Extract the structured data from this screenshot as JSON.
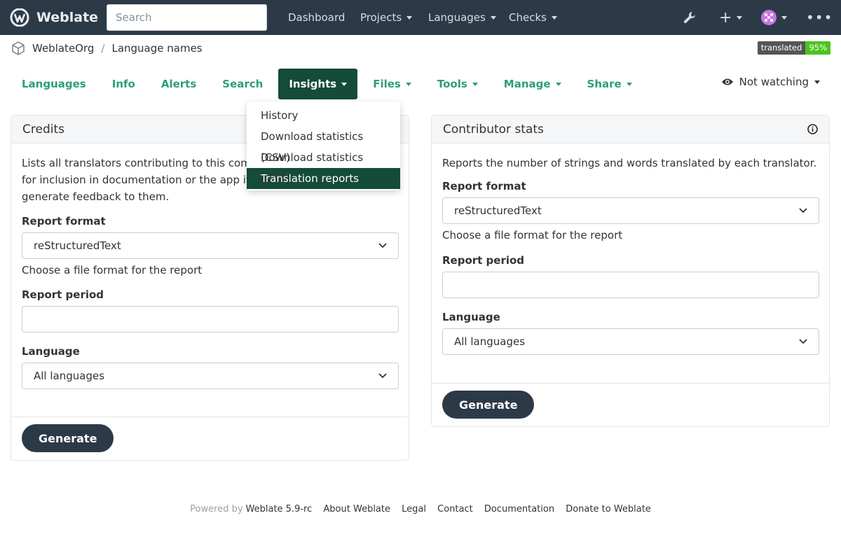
{
  "app": {
    "name": "Weblate"
  },
  "search": {
    "placeholder": "Search"
  },
  "topnav": {
    "dashboard": "Dashboard",
    "projects": "Projects",
    "languages": "Languages",
    "checks": "Checks"
  },
  "breadcrumb": {
    "project": "WeblateOrg",
    "component": "Language names"
  },
  "badge": {
    "label": "translated",
    "value": "95%"
  },
  "tabs": {
    "languages": "Languages",
    "info": "Info",
    "alerts": "Alerts",
    "search": "Search",
    "insights": "Insights",
    "files": "Files",
    "tools": "Tools",
    "manage": "Manage",
    "share": "Share"
  },
  "watch": {
    "label": "Not watching"
  },
  "insights_menu": {
    "items": [
      "History",
      "Download statistics (CSV)",
      "Download statistics (JSON)",
      "Translation reports"
    ]
  },
  "credits": {
    "title": "Credits",
    "description_lines": [
      "Lists all translators contributing to this compone",
      "for inclusion in documentation or the app itself, t",
      "generate feedback to them."
    ],
    "format_label": "Report format",
    "format_value": "reStructuredText",
    "format_help": "Choose a file format for the report",
    "period_label": "Report period",
    "period_value": "",
    "language_label": "Language",
    "language_value": "All languages",
    "generate": "Generate"
  },
  "stats": {
    "title": "Contributor stats",
    "description": "Reports the number of strings and words translated by each translator.",
    "format_label": "Report format",
    "format_value": "reStructuredText",
    "format_help": "Choose a file format for the report",
    "period_label": "Report period",
    "period_value": "",
    "language_label": "Language",
    "language_value": "All languages",
    "generate": "Generate"
  },
  "footer": {
    "powered_by": "Powered by",
    "version": "Weblate 5.9-rc",
    "about": "About Weblate",
    "legal": "Legal",
    "contact": "Contact",
    "documentation": "Documentation",
    "donate": "Donate to Weblate"
  },
  "colors": {
    "navbar": "#2c3a48",
    "accent": "#2c9d7a",
    "active_tab": "#144b3a",
    "badge_green": "#4ac41d"
  }
}
